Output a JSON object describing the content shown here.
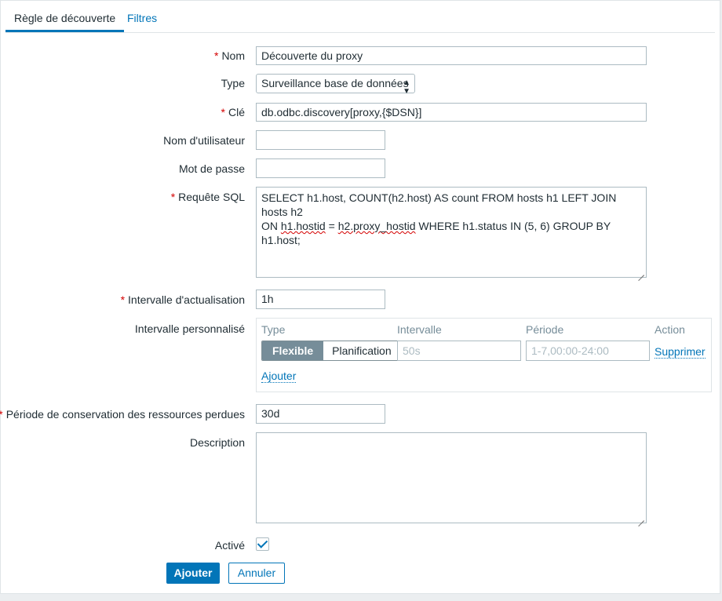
{
  "tabs": [
    {
      "label": "Règle de découverte",
      "active": true
    },
    {
      "label": "Filtres",
      "active": false
    }
  ],
  "required_marker": "*",
  "form": {
    "name": {
      "label": "Nom",
      "required": true,
      "value": "Découverte du proxy"
    },
    "type": {
      "label": "Type",
      "required": false,
      "value": "Surveillance base de données"
    },
    "key": {
      "label": "Clé",
      "required": true,
      "value": "db.odbc.discovery[proxy,{$DSN}]"
    },
    "username": {
      "label": "Nom d'utilisateur",
      "required": false,
      "value": ""
    },
    "password": {
      "label": "Mot de passe",
      "required": false,
      "value": ""
    },
    "sql_query": {
      "label": "Requête SQL",
      "required": true,
      "line1": "SELECT h1.host, COUNT(h2.host) AS count FROM hosts h1 LEFT JOIN hosts h2",
      "line2_pre": "ON ",
      "line2_sq1": "h1.hostid",
      "line2_mid": " = ",
      "line2_sq2": "h2.proxy_hostid",
      "line2_post": " WHERE h1.status IN (5, 6) GROUP BY h1.host;"
    },
    "update_interval": {
      "label": "Intervalle d'actualisation",
      "required": true,
      "value": "1h"
    },
    "custom_intervals": {
      "label": "Intervalle personnalisé",
      "columns": {
        "type": "Type",
        "interval": "Intervalle",
        "period": "Période",
        "action": "Action"
      },
      "row": {
        "flexible_label": "Flexible",
        "scheduling_label": "Planification",
        "interval_placeholder": "50s",
        "period_placeholder": "1-7,00:00-24:00",
        "remove_label": "Supprimer"
      },
      "add_label": "Ajouter"
    },
    "lost_resources": {
      "label": "Période de conservation des ressources perdues",
      "required": true,
      "value": "30d"
    },
    "description": {
      "label": "Description",
      "value": ""
    },
    "enabled": {
      "label": "Activé",
      "checked": true
    }
  },
  "buttons": {
    "add": "Ajouter",
    "cancel": "Annuler"
  },
  "colors": {
    "accent": "#0275b8",
    "required": "#d40000",
    "segment_active": "#768d99"
  }
}
